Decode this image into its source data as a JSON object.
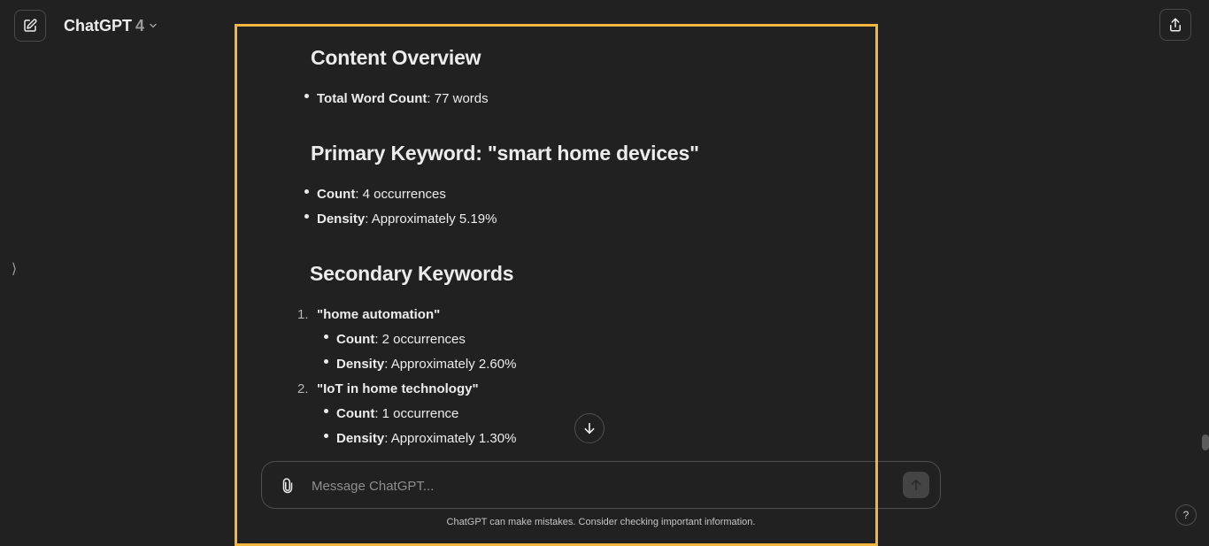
{
  "header": {
    "model_name": "ChatGPT",
    "model_version": "4",
    "new_chat_icon": "pencil-square-icon",
    "share_icon": "share-upload-icon",
    "dropdown_icon": "chevron-down-icon"
  },
  "sidebar": {
    "toggle_icon": "chevron-right-icon",
    "toggle_glyph": "⟩"
  },
  "message": {
    "sections": [
      {
        "heading": "Content Overview",
        "items": [
          {
            "label": "Total Word Count",
            "value": ": 77 words"
          }
        ]
      },
      {
        "heading": "Primary Keyword: \"smart home devices\"",
        "items": [
          {
            "label": "Count",
            "value": ": 4 occurrences"
          },
          {
            "label": "Density",
            "value": ": Approximately 5.19%"
          }
        ]
      },
      {
        "heading": "Secondary Keywords",
        "ordered": [
          {
            "number": "1.",
            "title": "\"home automation\"",
            "items": [
              {
                "label": "Count",
                "value": ": 2 occurrences"
              },
              {
                "label": "Density",
                "value": ": Approximately 2.60%"
              }
            ]
          },
          {
            "number": "2.",
            "title": "\"IoT in home technology\"",
            "items": [
              {
                "label": "Count",
                "value": ": 1 occurrence"
              },
              {
                "label": "Density",
                "value": ": Approximately 1.30%"
              }
            ]
          }
        ]
      }
    ]
  },
  "composer": {
    "placeholder": "Message ChatGPT...",
    "value": "",
    "attach_icon": "paperclip-icon",
    "send_icon": "arrow-up-icon"
  },
  "scroll_down_icon": "arrow-down-icon",
  "footer": {
    "disclaimer": "ChatGPT can make mistakes. Consider checking important information.",
    "help_label": "?"
  },
  "colors": {
    "background": "#212121",
    "text": "#ececec",
    "highlight": "#f2b53d",
    "border": "#4e4e4e"
  }
}
